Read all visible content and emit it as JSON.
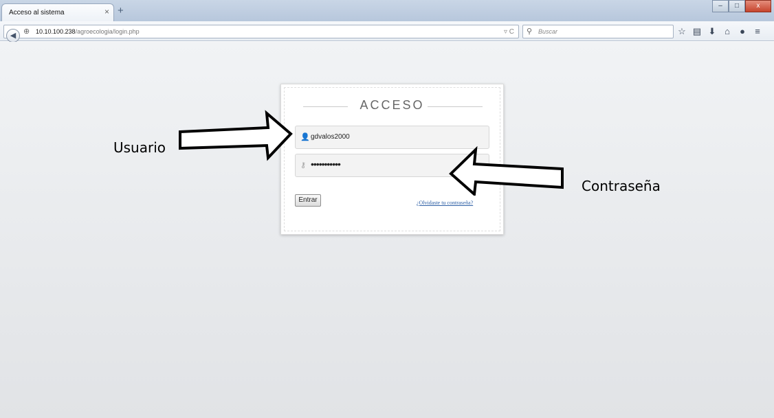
{
  "browser": {
    "tab_title": "Acceso al sistema",
    "tab_close_glyph": "×",
    "new_tab_glyph": "+",
    "window_buttons": [
      "–",
      "□",
      "x"
    ],
    "url_host": "10.10.100.238",
    "url_path": "/agroecologia/login.php",
    "url_controls": "▿ C",
    "search_placeholder": "Buscar",
    "toolbar_icons": [
      "star-icon",
      "reading-list-icon",
      "download-icon",
      "home-icon",
      "chat-icon",
      "menu-icon"
    ],
    "toolbar_glyphs": [
      "☆",
      "▤",
      "⬇",
      "⌂",
      "●",
      "≡"
    ]
  },
  "login": {
    "title": "ACCESO",
    "username_value": "gdvalos2000",
    "password_mask": "•••••••••••",
    "submit_label": "Entrar",
    "forgot_link": "¿Olvidaste tu contraseña?"
  },
  "annotations": {
    "username_label": "Usuario",
    "password_label": "Contraseña"
  },
  "colors": {
    "link": "#2d5fa5",
    "page_background": "#eaecee",
    "tab_strip": "#c0cee0"
  }
}
